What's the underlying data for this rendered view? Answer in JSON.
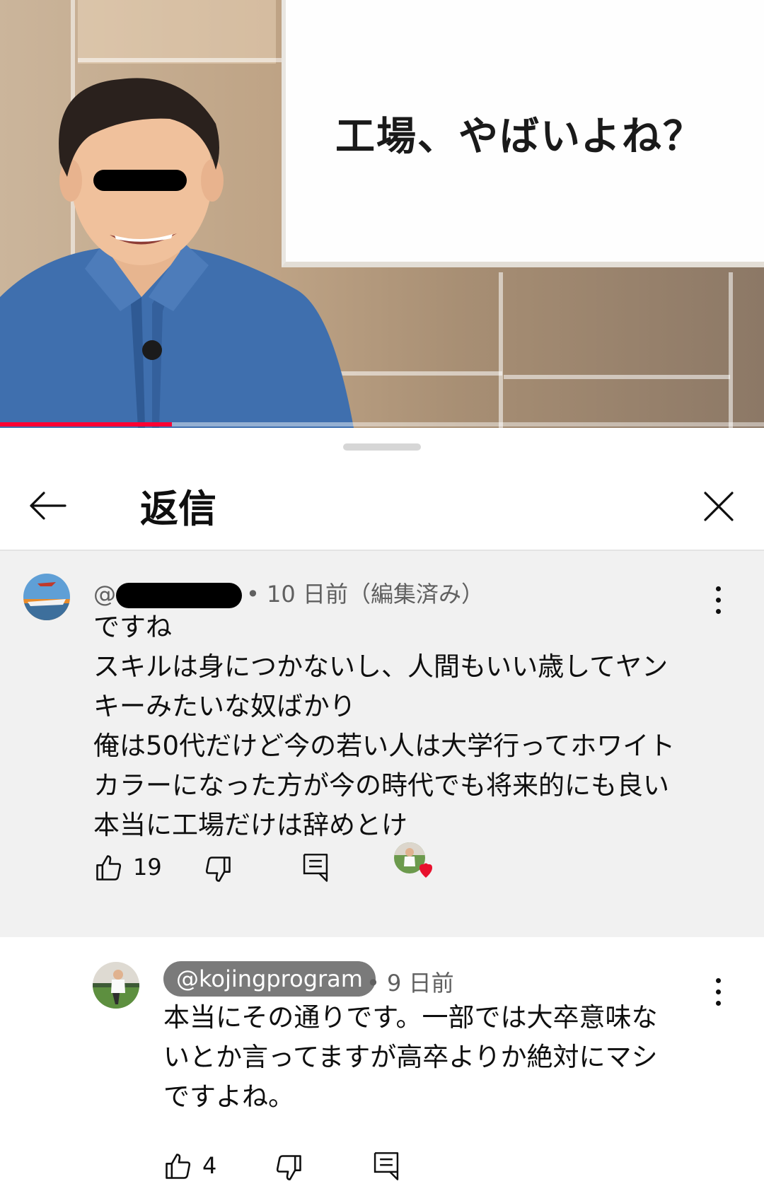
{
  "video": {
    "overlay_text": "工場、やばいよね？",
    "progress_fraction": 0.225
  },
  "sheet": {
    "title": "返信"
  },
  "parent_comment": {
    "author_prefix": "@",
    "meta": "• 10 日前（編集済み）",
    "text": "ですね\nスキルは身につかないし、人間もいい歳してヤン\nキーみたいな奴ばかり\n俺は50代だけど今の若い人は大学行ってホワイト\nカラーになった方が今の時代でも将来的にも良い\n本当に工場だけは辞めとけ",
    "likes": "19"
  },
  "reply": {
    "author": "@kojingprogram",
    "meta": "• 9 日前",
    "text": "本当にその通りです。一部では大卒意味な\nいとか言ってますが高卒よりか絶対にマシ\nですよね。",
    "likes": "4"
  },
  "colors": {
    "progress": "#ff0033",
    "heart": "#e8112d",
    "comment_bg": "#f1f1f1"
  }
}
